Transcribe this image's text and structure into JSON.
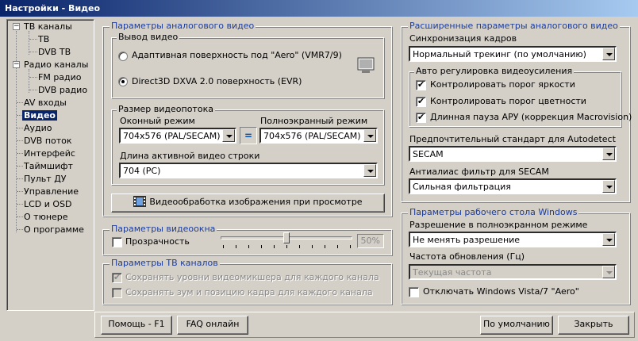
{
  "window": {
    "title": "Настройки - Видео"
  },
  "tree": {
    "items": [
      {
        "label": "ТВ каналы",
        "level": 0,
        "expander": "-"
      },
      {
        "label": "ТВ",
        "level": 1
      },
      {
        "label": "DVB ТВ",
        "level": 1
      },
      {
        "label": "Радио каналы",
        "level": 0,
        "expander": "-"
      },
      {
        "label": "FM радио",
        "level": 1
      },
      {
        "label": "DVB радио",
        "level": 1
      },
      {
        "label": "AV входы",
        "level": 0
      },
      {
        "label": "Видео",
        "level": 0,
        "selected": true
      },
      {
        "label": "Аудио",
        "level": 0
      },
      {
        "label": "DVB поток",
        "level": 0
      },
      {
        "label": "Интерфейс",
        "level": 0
      },
      {
        "label": "Таймшифт",
        "level": 0
      },
      {
        "label": "Пульт ДУ",
        "level": 0
      },
      {
        "label": "Управление",
        "level": 0
      },
      {
        "label": "LCD и OSD",
        "level": 0
      },
      {
        "label": "О тюнере",
        "level": 0
      },
      {
        "label": "О программе",
        "level": 0
      }
    ]
  },
  "analog": {
    "title": "Параметры аналогового видео",
    "output": {
      "title": "Вывод видео",
      "option1": "Адаптивная поверхность под \"Aero\" (VMR7/9)",
      "option2": "Direct3D DXVA 2.0 поверхность (EVR)",
      "selected": 2
    },
    "size": {
      "title": "Размер видеопотока",
      "windowed_label": "Оконный режим",
      "windowed_value": "704x576 (PAL/SECAM)",
      "equal_label": "=",
      "fullscreen_label": "Полноэкранный режим",
      "fullscreen_value": "704x576 (PAL/SECAM)",
      "active_label": "Длина активной видео строки",
      "active_value": "704 (PC)"
    },
    "processing_button": "Видеообработка изображения при просмотре"
  },
  "window_params": {
    "title": "Параметры видеоокна",
    "transparency_label": "Прозрачность",
    "transparency_checked": false,
    "transparency_value": "50%",
    "slider_fraction": 0.5
  },
  "tv_params": {
    "title": "Параметры ТВ каналов",
    "save_mixer_label": "Сохранять уровни видеомикшера для каждого канала",
    "save_mixer_checked": true,
    "save_zoom_label": "Сохранять зум и позицию кадра для каждого канала",
    "save_zoom_checked": false
  },
  "advanced": {
    "title": "Расширенные параметры аналогового видео",
    "sync_label": "Синхронизация кадров",
    "sync_value": "Нормальный трекинг (по умолчанию)",
    "agc": {
      "title": "Авто регулировка видеоусиления",
      "brightness": "Контролировать порог яркости",
      "chroma": "Контролировать порог цветности",
      "long_pause": "Длинная пауза АРУ (коррекция Macrovision)"
    },
    "standard_label": "Предпочтительный стандарт для Autodetect",
    "standard_value": "SECAM",
    "antialias_label": "Антиалиас фильтр для SECAM",
    "antialias_value": "Сильная фильтрация"
  },
  "desktop": {
    "title": "Параметры рабочего стола Windows",
    "resolution_label": "Разрешение в полноэкранном режиме",
    "resolution_value": "Не менять разрешение",
    "refresh_label": "Частота обновления (Гц)",
    "refresh_value": "Текущая частота",
    "aero_label": "Отключать Windows Vista/7 \"Aero\"",
    "aero_checked": false
  },
  "footer": {
    "help": "Помощь - F1",
    "faq": "FAQ онлайн",
    "defaults": "По умолчанию",
    "close": "Закрыть"
  },
  "colors": {
    "group_title": "#1c3c9c",
    "selection": "#0a246a",
    "face": "#d4d0c8"
  }
}
